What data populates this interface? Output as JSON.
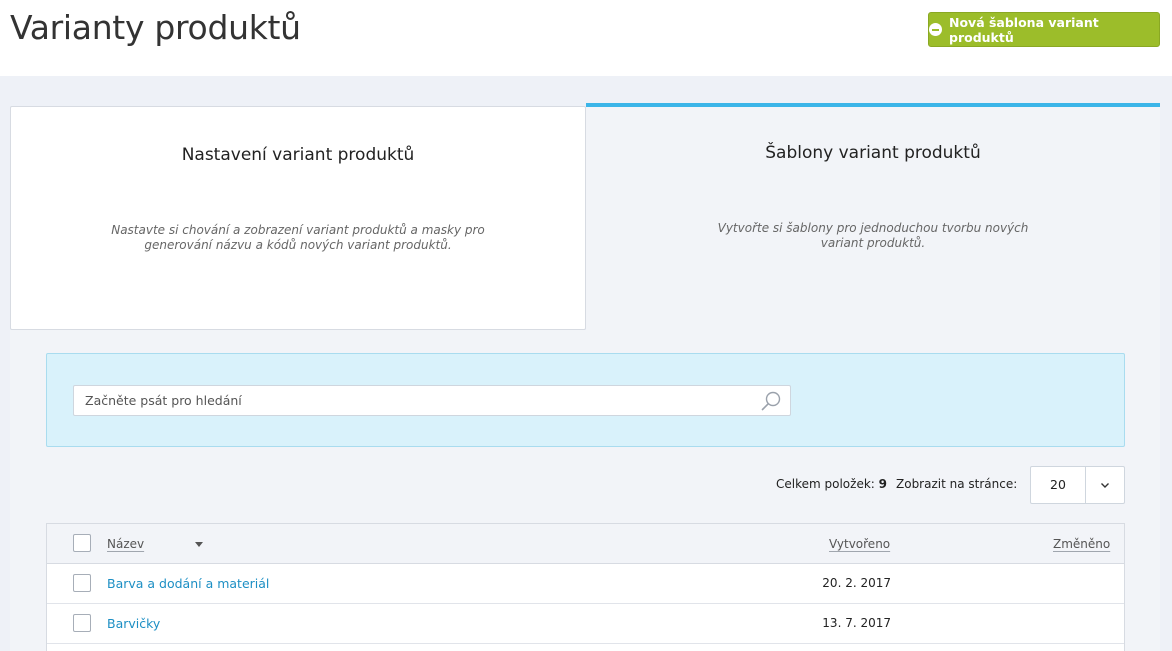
{
  "header": {
    "title": "Varianty produktů",
    "new_button_label": "Nová šablona variant produktů"
  },
  "tabs": [
    {
      "title": "Nastavení variant produktů",
      "description": "Nastavte si chování a zobrazení variant produktů a masky pro generování názvu a kódů nových variant produktů.",
      "active": false
    },
    {
      "title": "Šablony variant produktů",
      "description": "Vytvořte si šablony pro jednoduchou tvorbu nových variant produktů.",
      "active": true
    }
  ],
  "search": {
    "placeholder": "Začněte psát pro hledání",
    "value": ""
  },
  "listing": {
    "total_label": "Celkem položek:",
    "total_count": "9",
    "per_page_label": "Zobrazit na stránce:",
    "per_page_value": "20"
  },
  "table": {
    "columns": {
      "name": "Název",
      "created": "Vytvořeno",
      "modified": "Změněno"
    },
    "rows": [
      {
        "name": "Barva a dodání a materiál",
        "created": "20. 2. 2017",
        "modified": ""
      },
      {
        "name": "Barvičky",
        "created": "13. 7. 2017",
        "modified": ""
      }
    ]
  },
  "colors": {
    "primary_button": "#9cbd2a",
    "active_tab_accent": "#3bb5e8",
    "link": "#1d8fc4",
    "search_panel": "#d9f2fb"
  },
  "icons": {
    "new_button": "plus-circle-icon",
    "search": "search-icon",
    "per_page": "chevron-down-icon",
    "sort": "sort-down-icon"
  }
}
